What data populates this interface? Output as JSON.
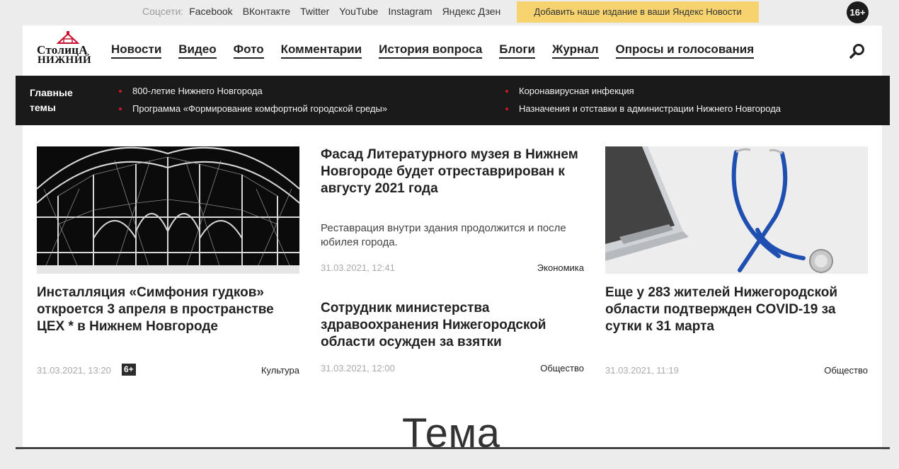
{
  "topbar": {
    "social_label": "Соцсети:",
    "social_links": [
      "Facebook",
      "ВКонтакте",
      "Twitter",
      "YouTube",
      "Instagram",
      "Яндекс Дзен"
    ],
    "dzen_button": "Добавить наше издание в ваши Яндекс Новости",
    "age_rating": "16+"
  },
  "logo": {
    "line1": "СтолицА",
    "line2": "НИЖНИЙ"
  },
  "nav": [
    "Новости",
    "Видео",
    "Фото",
    "Комментарии",
    "История вопроса",
    "Блоги",
    "Журнал",
    "Опросы и голосования"
  ],
  "main_topics": {
    "title": "Главные темы",
    "col1": [
      "800-летие Нижнего Новгорода",
      "Программа «Формирование комфортной городской среды»"
    ],
    "col2": [
      "Коронавирусная инфекция",
      "Назначения и отставки в администрации Нижнего Новгорода"
    ],
    "bullet_color": "#d0142a"
  },
  "cards": {
    "left": {
      "headline": "Инсталляция «Симфония гудков» откроется 3 апреля в пространстве ЦЕХ * в Нижнем Новгороде",
      "date": "31.03.2021, 13:20",
      "age": "6+",
      "category": "Культура"
    },
    "middle_top": {
      "headline": "Фасад Литературного музея в Нижнем Новгороде будет отреставрирован к августу 2021 года",
      "lead": "Реставрация внутри здания продолжится и после юбилея города.",
      "date": "31.03.2021, 12:41",
      "category": "Экономика"
    },
    "middle_bottom": {
      "headline": "Сотрудник министерства здравоохранения Нижегородской области осужден за взятки",
      "date": "31.03.2021, 12:00",
      "category": "Общество"
    },
    "right": {
      "headline": "Еще у 283 жителей Нижегородской области подтвержден COVID-19 за сутки к 31 марта",
      "date": "31.03.2021, 11:19",
      "category": "Общество"
    }
  },
  "section_title": "Тема",
  "colors": {
    "accent_yellow": "#f6d36e",
    "dark_band": "#1a1a1a",
    "red_bullet": "#d0142a"
  }
}
